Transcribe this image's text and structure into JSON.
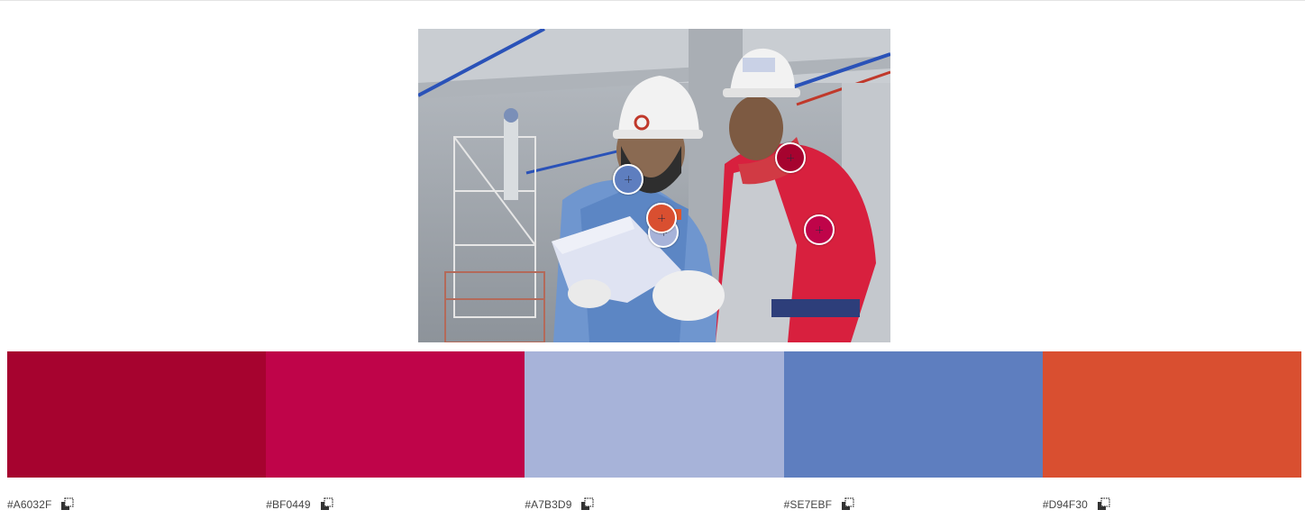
{
  "image": {
    "alt_subject": "construction-workers-photo"
  },
  "pickers": [
    {
      "color": "#5E7EBF"
    },
    {
      "color": "#A7B3D9"
    },
    {
      "color": "#D94F30"
    },
    {
      "color": "#A6032F"
    },
    {
      "color": "#BF0449"
    }
  ],
  "palette": [
    {
      "hex": "#A6032F",
      "label": "#A6032F",
      "copy_icon": "copy-icon"
    },
    {
      "hex": "#BF0449",
      "label": "#BF0449",
      "copy_icon": "copy-icon"
    },
    {
      "hex": "#A7B3D9",
      "label": "#A7B3D9",
      "copy_icon": "copy-icon"
    },
    {
      "hex": "#5E7EBF",
      "label": "#SE7EBF",
      "copy_icon": "copy-icon"
    },
    {
      "hex": "#D94F30",
      "label": "#D94F30",
      "copy_icon": "copy-icon"
    }
  ]
}
